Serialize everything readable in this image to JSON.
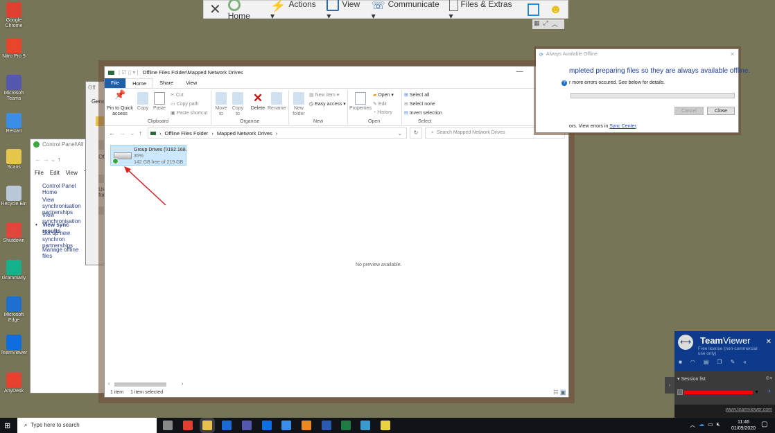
{
  "desktop_icons": [
    {
      "label": "Google Chrome",
      "color": "#e04030"
    },
    {
      "label": "Nitro Pro 9",
      "color": "#e8452c"
    },
    {
      "label": "Microsoft Teams",
      "color": "#5558af"
    },
    {
      "label": "Restart",
      "color": "#3a8ee6"
    },
    {
      "label": "Scans",
      "color": "#e6c64a"
    },
    {
      "label": "Recycle Bin",
      "color": "#b8c8d8"
    },
    {
      "label": "Shutdown",
      "color": "#e2453c"
    },
    {
      "label": "Grammarly",
      "color": "#15b08c"
    },
    {
      "label": "Microsoft Edge",
      "color": "#1f6fd0"
    },
    {
      "label": "TeamViewer",
      "color": "#0e6ee0"
    },
    {
      "label": "AnyDesk",
      "color": "#e8402f"
    }
  ],
  "tv_toolbar": {
    "home": "Home",
    "actions": "Actions",
    "view": "View",
    "communicate": "Communicate",
    "files": "Files & Extras"
  },
  "control_panel": {
    "title": "Control Panel\\All Co",
    "menu": [
      "File",
      "Edit",
      "View",
      "To"
    ],
    "links": [
      "Control Panel Home",
      "View synchronisation partnerships",
      "View synchronisation",
      "View sync results",
      "Set up new synchron partnerships",
      "Manage offline files"
    ]
  },
  "offline_props": {
    "title": "Off",
    "tab": "Genera",
    "text1": "Off",
    "text2": "Use for"
  },
  "explorer": {
    "title": "Offline Files Folder\\Mapped Network Drives",
    "tabs": [
      "File",
      "Home",
      "Share",
      "View"
    ],
    "ribbon": {
      "pin": "Pin to Quick access",
      "copy": "Copy",
      "paste": "Paste",
      "cut": "Cut",
      "copy_path": "Copy path",
      "paste_shortcut": "Paste shortcut",
      "move_to": "Move to",
      "copy_to": "Copy to",
      "delete": "Delete",
      "rename": "Rename",
      "new_folder": "New folder",
      "new_item": "New item",
      "easy_access": "Easy access",
      "properties": "Properties",
      "open": "Open",
      "edit": "Edit",
      "history": "History",
      "select_all": "Select all",
      "select_none": "Select none",
      "invert_selection": "Invert selection",
      "groups": [
        "Clipboard",
        "Organise",
        "New",
        "Open",
        "Select"
      ]
    },
    "breadcrumb": [
      "Offline Files Folder",
      "Mapped Network Drives"
    ],
    "search_placeholder": "Search Mapped Network Drives",
    "drive": {
      "name": "Group Drives (\\\\192.168.",
      "percent": "35%",
      "free": "142 GB free of 219 GB",
      "used_fraction": 0.35
    },
    "preview": "No preview available.",
    "status": {
      "items": "1 item",
      "selected": "1 item selected"
    }
  },
  "offline_dialog": {
    "title": "Always Available Offline",
    "heading": "mpleted preparing files so they are always available offline.",
    "error": "r more errors occured. See below for details.",
    "cancel": "Cancel",
    "close": "Close",
    "footer": "ors. View errors in ",
    "link": "Sync Center",
    "link_end": "."
  },
  "teamviewer": {
    "brand_bold": "Team",
    "brand_light": "Viewer",
    "license": "Free license (non-commercial use only)",
    "session_list": "Session list",
    "url": "www.teamviewer.com"
  },
  "taskbar": {
    "search_placeholder": "Type here to search",
    "time": "11:46",
    "date": "01/09/2020"
  }
}
